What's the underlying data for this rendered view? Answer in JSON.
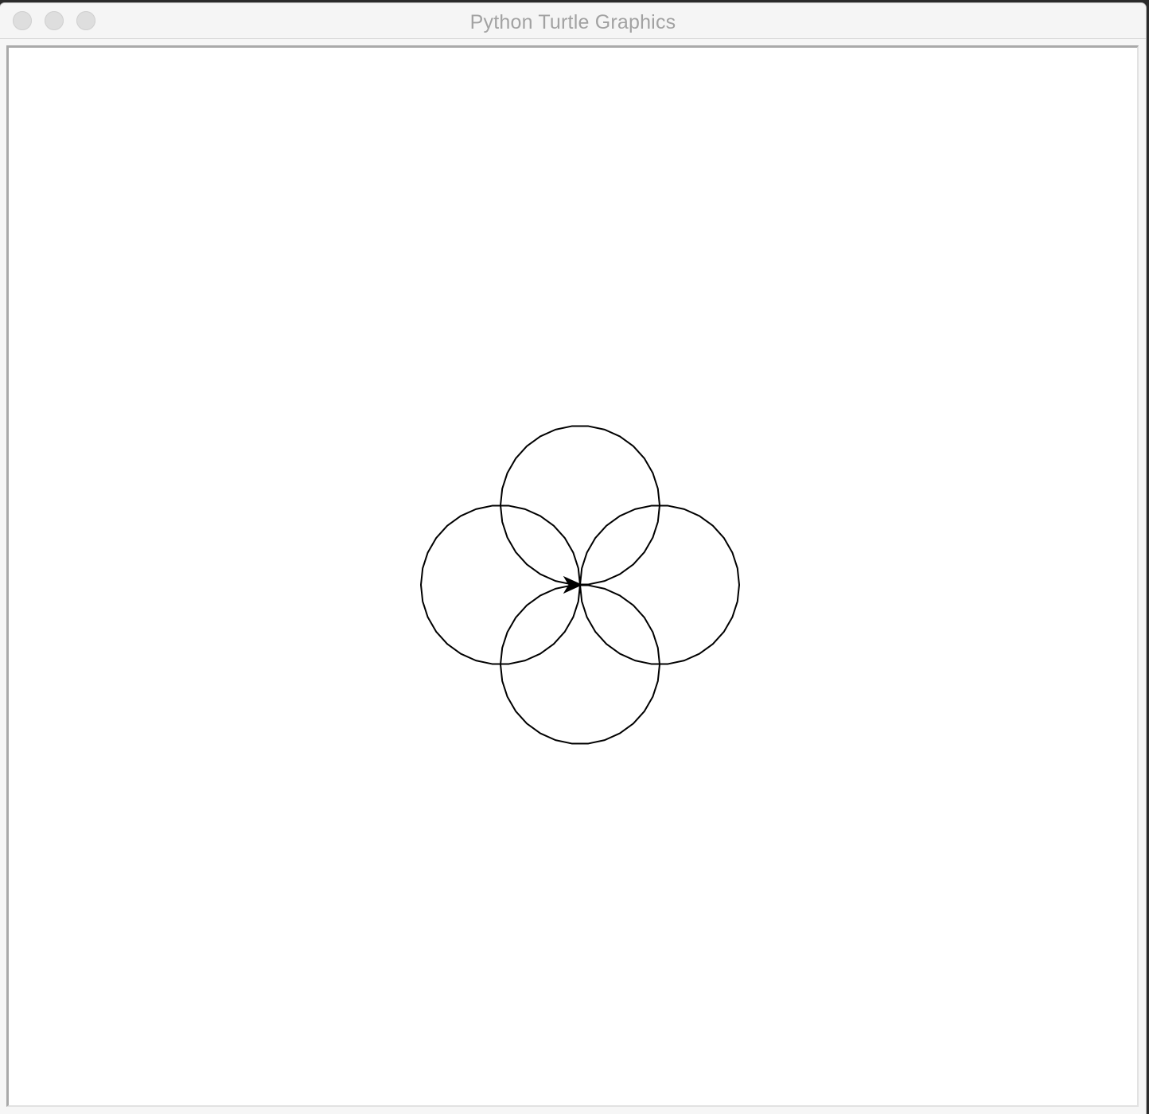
{
  "window": {
    "title": "Python Turtle Graphics"
  },
  "titlebar": {
    "buttons": [
      {
        "name": "close-button",
        "color": "#dedede"
      },
      {
        "name": "minimize-button",
        "color": "#dedede"
      },
      {
        "name": "zoom-button",
        "color": "#dedede"
      }
    ]
  },
  "drawing": {
    "pen_color": "#000000",
    "background": "#ffffff",
    "shapes": [
      "circle-top",
      "circle-right",
      "circle-bottom",
      "circle-left"
    ],
    "turtle_icon": "turtle-arrow-icon",
    "turtle_heading": "east"
  }
}
